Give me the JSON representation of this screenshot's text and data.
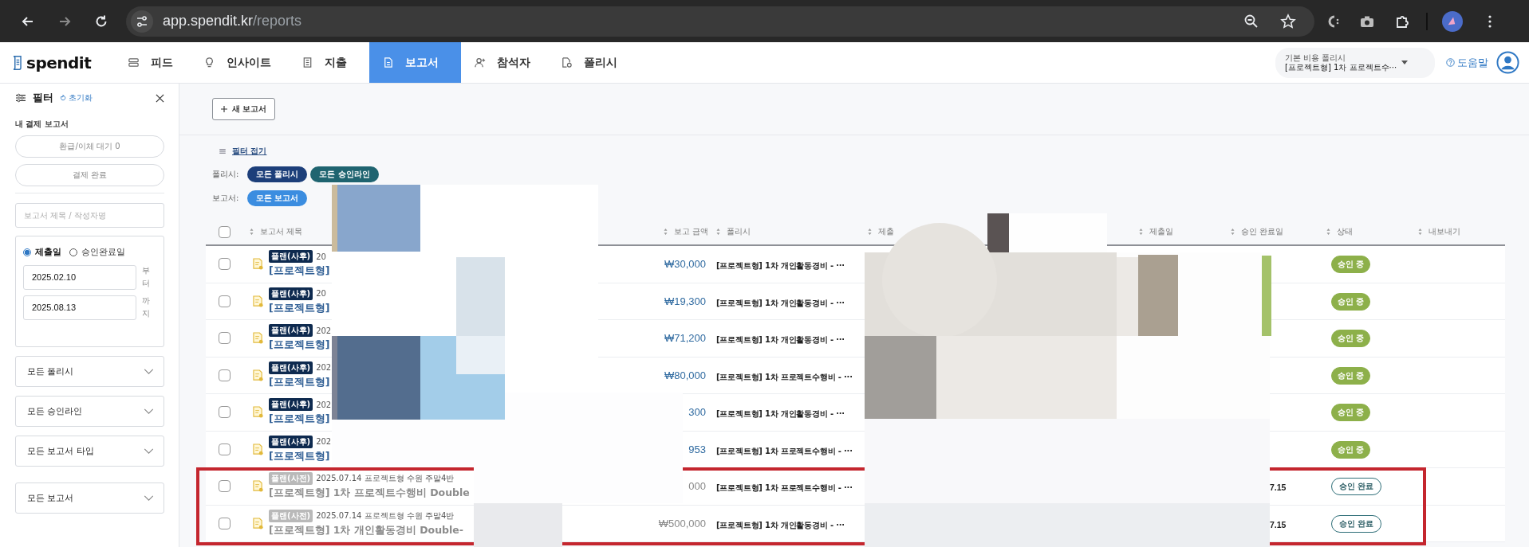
{
  "browser": {
    "url_host": "app.spendit.kr",
    "url_path": "/reports"
  },
  "app": {
    "logo": "spendit",
    "nav": [
      {
        "label": "피드",
        "selected": false
      },
      {
        "label": "인사이트",
        "selected": false
      },
      {
        "label": "지출",
        "selected": false
      },
      {
        "label": "보고서",
        "selected": true
      },
      {
        "label": "참석자",
        "selected": false
      },
      {
        "label": "폴리시",
        "selected": false
      }
    ],
    "policy_picker": {
      "label": "기본 비용 폴리시",
      "value": "[프로젝트형] 1차 프로젝트수···"
    },
    "help": "도움말"
  },
  "filter_panel": {
    "title": "필터",
    "reset": "초기화",
    "section_title": "내 결제 보고서",
    "quick_filters": [
      "환급/이체 대기 0",
      "결제 완료"
    ],
    "search": {
      "placeholder": "보고서 제목 / 작성자명"
    },
    "date_types": [
      {
        "label": "제출일",
        "selected": true
      },
      {
        "label": "승인완료일",
        "selected": false
      }
    ],
    "date_from": {
      "value": "2025.02.10",
      "suffix": "부터"
    },
    "date_to": {
      "value": "2025.08.13",
      "suffix": "까지"
    },
    "dropdowns": [
      "모든 폴리시",
      "모든 승인라인",
      "모든 보고서 타입",
      "모든 보고서"
    ]
  },
  "toolbar": {
    "new_report": "새 보고서"
  },
  "filters": {
    "toggle": "필터 접기",
    "groups": [
      {
        "label": "폴리시:",
        "chips": [
          {
            "label": "모든 폴리시",
            "color": "#1d3f7a"
          },
          {
            "label": "모든 승인라인",
            "color": "#1f6470"
          }
        ]
      },
      {
        "label": "보고서:",
        "chips": [
          {
            "label": "모든 보고서",
            "color": "#3b8de0"
          }
        ]
      }
    ]
  },
  "table": {
    "header_checked": false,
    "columns": [
      "보고서 제목",
      "보고 금액",
      "폴리시",
      "제출",
      "제출일",
      "승인 완료일",
      "상태",
      "내보내기"
    ],
    "rows": [
      {
        "checked": false,
        "dimmed": false,
        "badge": "플랜(사후)",
        "meta": "20",
        "title": "[프로젝트형]",
        "amount": "₩30,000",
        "policy": "[프로젝트형] 1차 개인활동경비 - ···",
        "status": {
          "label": "승인 중",
          "kind": "pending"
        }
      },
      {
        "checked": false,
        "dimmed": false,
        "badge": "플랜(사후)",
        "meta": "20",
        "title": "[프로젝트형]",
        "amount": "₩19,300",
        "policy": "[프로젝트형] 1차 개인활동경비 - ···",
        "status": {
          "label": "승인 중",
          "kind": "pending"
        }
      },
      {
        "checked": false,
        "dimmed": false,
        "badge": "플랜(사후)",
        "meta": "202",
        "title": "[프로젝트형]",
        "amount": "₩71,200",
        "policy": "[프로젝트형] 1차 개인활동경비 - ···",
        "status": {
          "label": "승인 중",
          "kind": "pending"
        }
      },
      {
        "checked": false,
        "dimmed": false,
        "badge": "플랜(사후)",
        "meta": "202",
        "title": "[프로젝트형]",
        "amount": "₩80,000",
        "policy": "[프로젝트형] 1차 프로젝트수행비 - ···",
        "status": {
          "label": "승인 중",
          "kind": "pending"
        }
      },
      {
        "checked": false,
        "dimmed": false,
        "badge": "플랜(사후)",
        "meta": "202",
        "title": "[프로젝트형]",
        "amount": "300",
        "policy": "[프로젝트형] 1차 개인활동경비 - ···",
        "status": {
          "label": "승인 중",
          "kind": "pending"
        }
      },
      {
        "checked": false,
        "dimmed": false,
        "badge": "플랜(사후)",
        "meta": "202",
        "title": "[프로젝트형]",
        "amount": "953",
        "policy": "[프로젝트형] 1차 프로젝트수행비 - ···",
        "status": {
          "label": "승인 중",
          "kind": "pending"
        }
      },
      {
        "checked": false,
        "dimmed": true,
        "badge": "플랜(사전)",
        "meta": "2025.07.14 프로젝트형 수원 주말4반",
        "title": "[프로젝트형] 1차 프로젝트수행비 Double",
        "amount": "000",
        "policy": "[프로젝트형] 1차 프로젝트수행비 - ···",
        "approved_date": "7.15",
        "status": {
          "label": "승인 완료",
          "kind": "approved"
        }
      },
      {
        "checked": false,
        "dimmed": true,
        "badge": "플랜(사전)",
        "meta": "2025.07.14 프로젝트형 수원 주말4반",
        "title": "[프로젝트형] 1차 개인활동경비 Double-",
        "amount": "₩500,000",
        "policy": "[프로젝트형] 1차 개인활동경비 - ···",
        "approved_date": "7.15",
        "status": {
          "label": "승인 완료",
          "kind": "approved"
        }
      }
    ]
  }
}
